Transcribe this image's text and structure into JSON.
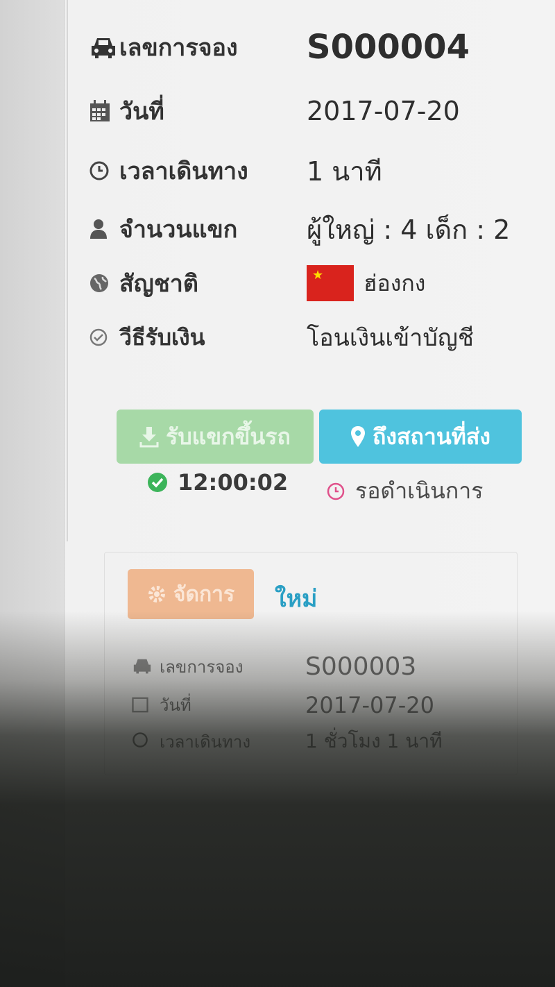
{
  "booking": {
    "rows": [
      {
        "label": "เลขการจอง",
        "value": "S000004"
      },
      {
        "label": "วันที่",
        "value": "2017-07-20"
      },
      {
        "label": "เวลาเดินทาง",
        "value": "1 นาที"
      },
      {
        "label": "จำนวนแขก",
        "value": "ผู้ใหญ่ : 4  เด็ก : 2"
      },
      {
        "label": "สัญชาติ",
        "value": "ฮ่องกง"
      },
      {
        "label": "วีธีรับเงิน",
        "value": "โอนเงินเข้าบัญชี"
      }
    ],
    "actions": {
      "pickup_label": "รับแขกขึ้นรถ",
      "arrive_label": "ถึงสถานที่ส่ง"
    },
    "status": {
      "pickup_time": "12:00:02",
      "arrive_status": "รอดำเนินการ"
    }
  },
  "booking2": {
    "manage_label": "จัดการ",
    "new_label": "ใหม่",
    "rows": [
      {
        "label": "เลขการจอง",
        "value": "S000003"
      },
      {
        "label": "วันที่",
        "value": "2017-07-20"
      },
      {
        "label": "เวลาเดินทาง",
        "value": "1 ชั่วโมง 1 นาที"
      }
    ]
  },
  "icons": {
    "booking_no": "car-icon",
    "date": "calendar-icon",
    "travel_time": "clock-icon",
    "guests": "user-icon",
    "nationality": "globe-icon",
    "payment": "check-circle-icon",
    "pickup": "download-icon",
    "arrive": "map-marker-icon",
    "status_done": "check-circle-icon",
    "status_pending": "clock-icon",
    "manage": "gear-icon"
  },
  "colors": {
    "pickup_button": "#a7d9a7",
    "arrive_button": "#4fc3de",
    "manage_button": "#efb891",
    "new_link": "#2a9fc4",
    "done": "#3cb45a",
    "pending": "#e0508a",
    "flag_red": "#d9231d",
    "flag_star": "#ffde00"
  }
}
